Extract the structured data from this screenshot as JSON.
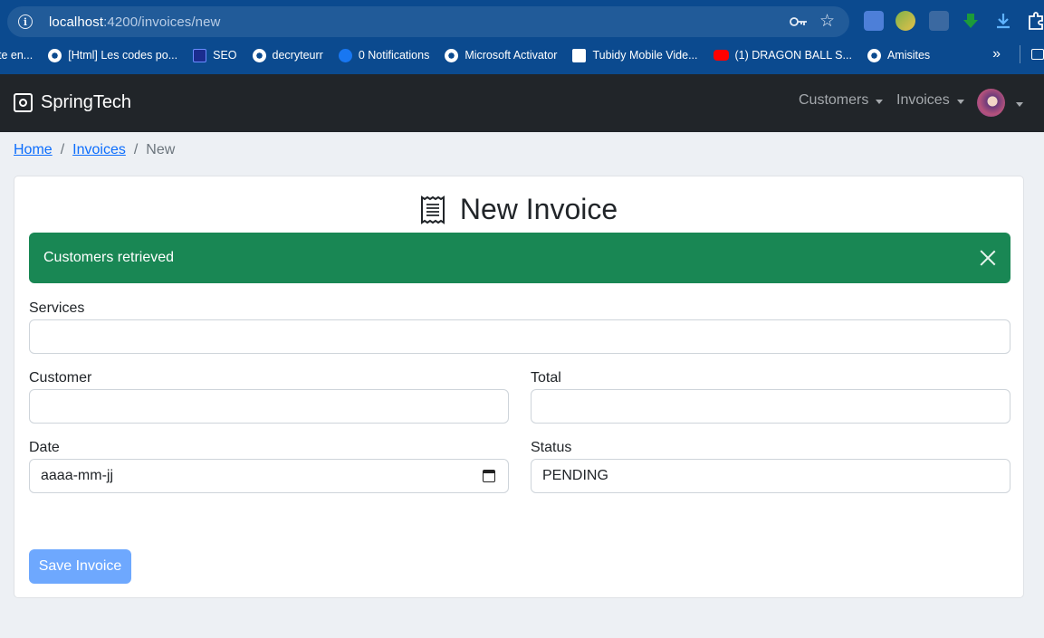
{
  "browser": {
    "url_host": "localhost",
    "url_path": ":4200/invoices/new",
    "bookmarks": [
      {
        "label": "te en...",
        "icon": "truncated"
      },
      {
        "label": "[Html] Les codes po...",
        "icon": "globe-icon"
      },
      {
        "label": "SEO",
        "icon": "seo-icon"
      },
      {
        "label": "decryteurr",
        "icon": "globe-icon"
      },
      {
        "label": "0 Notifications",
        "icon": "facebook-icon"
      },
      {
        "label": "Microsoft Activator",
        "icon": "globe-icon"
      },
      {
        "label": "Tubidy Mobile Vide...",
        "icon": "tubidy-icon"
      },
      {
        "label": "(1) DRAGON BALL S...",
        "icon": "youtube-icon"
      },
      {
        "label": "Amisites",
        "icon": "globe-icon"
      }
    ],
    "more_label": "»"
  },
  "navbar": {
    "brand": "SpringTech",
    "customers": "Customers",
    "invoices": "Invoices"
  },
  "breadcrumb": {
    "home": "Home",
    "invoices": "Invoices",
    "current": "New",
    "separator": "/"
  },
  "form": {
    "title": "New Invoice",
    "alert": "Customers retrieved",
    "services_label": "Services",
    "customer_label": "Customer",
    "total_label": "Total",
    "date_label": "Date",
    "date_placeholder": "aaaa-mm-jj",
    "status_label": "Status",
    "status_value": "PENDING",
    "save_label": "Save Invoice"
  },
  "colors": {
    "navbar": "#212529",
    "alert": "#198754",
    "button": "#6ea8fe",
    "link": "#0d6efd"
  }
}
